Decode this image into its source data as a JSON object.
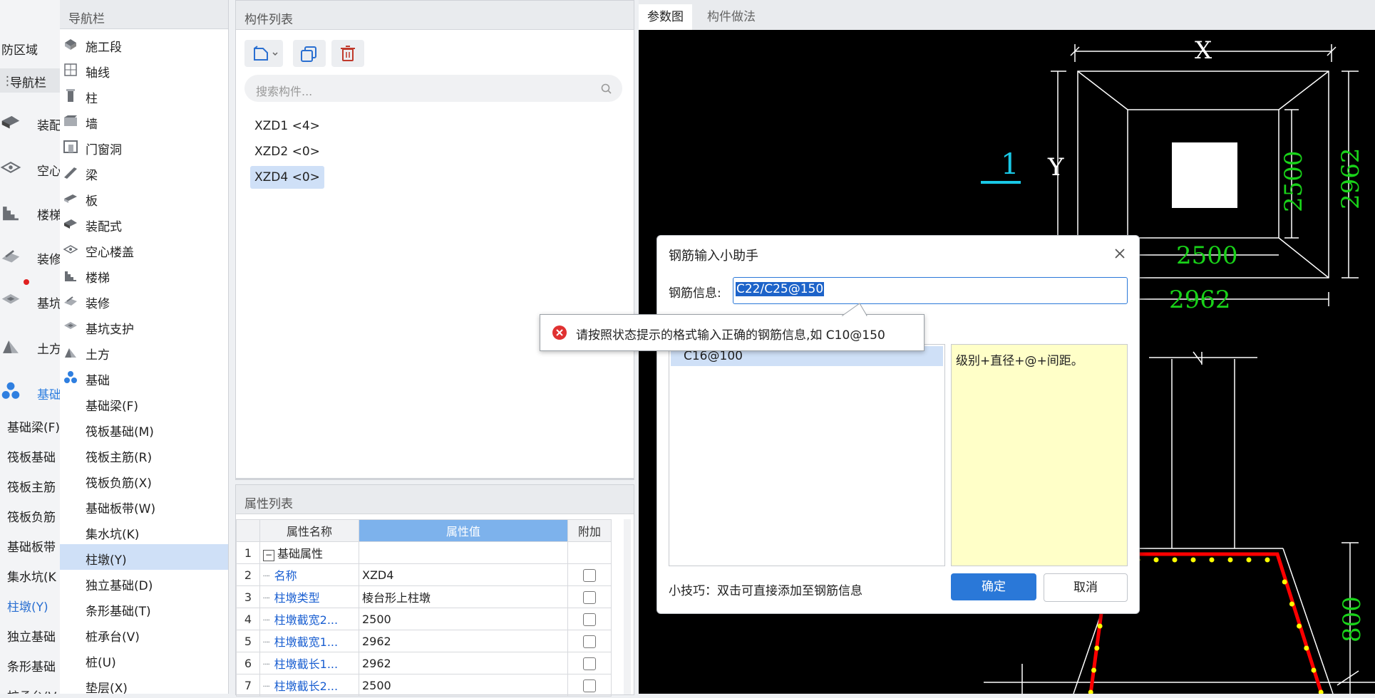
{
  "left_strip": {
    "top_label": "防区域",
    "nav_label": "导航栏",
    "items": [
      {
        "label": "装配",
        "icon": "prefab-icon"
      },
      {
        "label": "空心",
        "icon": "hollow-slab-icon"
      },
      {
        "label": "楼梯",
        "icon": "stairs-icon"
      },
      {
        "label": "装修",
        "icon": "decoration-icon"
      },
      {
        "label": "基坑",
        "icon": "pit-support-icon"
      },
      {
        "label": "土方",
        "icon": "earthwork-icon"
      },
      {
        "label": "基础",
        "icon": "foundation-icon"
      }
    ],
    "sub_items": [
      "基础梁(F)",
      "筏板基础",
      "筏板主筋",
      "筏板负筋",
      "基础板带",
      "集水坑(K",
      "柱墩(Y)",
      "独立基础",
      "条形基础",
      "桩承台(V"
    ]
  },
  "nav_panel": {
    "title": "导航栏",
    "items": [
      {
        "label": "施工段",
        "icon": "construction-segment-icon"
      },
      {
        "label": "轴线",
        "icon": "axis-grid-icon"
      },
      {
        "label": "柱",
        "icon": "column-icon"
      },
      {
        "label": "墙",
        "icon": "wall-icon"
      },
      {
        "label": "门窗洞",
        "icon": "door-window-icon"
      },
      {
        "label": "梁",
        "icon": "beam-icon"
      },
      {
        "label": "板",
        "icon": "slab-icon"
      },
      {
        "label": "装配式",
        "icon": "prefab-icon"
      },
      {
        "label": "空心楼盖",
        "icon": "hollow-slab-icon"
      },
      {
        "label": "楼梯",
        "icon": "stairs-icon"
      },
      {
        "label": "装修",
        "icon": "decoration-icon"
      },
      {
        "label": "基坑支护",
        "icon": "pit-support-icon"
      },
      {
        "label": "土方",
        "icon": "earthwork-icon"
      },
      {
        "label": "基础",
        "icon": "foundation-icon"
      }
    ],
    "sub_items": [
      "基础梁(F)",
      "筏板基础(M)",
      "筏板主筋(R)",
      "筏板负筋(X)",
      "基础板带(W)",
      "集水坑(K)",
      "柱墩(Y)",
      "独立基础(D)",
      "条形基础(T)",
      "桩承台(V)",
      "桩(U)",
      "垫层(X)"
    ],
    "selected_sub": "柱墩(Y)"
  },
  "component_list": {
    "title": "构件列表",
    "search_placeholder": "搜索构件...",
    "items": [
      "XZD1 <4>",
      "XZD2 <0>",
      "XZD4 <0>"
    ],
    "selected": "XZD4 <0>"
  },
  "property_list": {
    "title": "属性列表",
    "headers": [
      "属性名称",
      "属性值",
      "附加"
    ],
    "rows": [
      {
        "num": "1",
        "name": "基础属性",
        "value": "",
        "group": true
      },
      {
        "num": "2",
        "name": "名称",
        "value": "XZD4"
      },
      {
        "num": "3",
        "name": "柱墩类型",
        "value": "棱台形上柱墩"
      },
      {
        "num": "4",
        "name": "柱墩截宽2...",
        "value": "2500"
      },
      {
        "num": "5",
        "name": "柱墩截宽1...",
        "value": "2962"
      },
      {
        "num": "6",
        "name": "柱墩截长1...",
        "value": "2962"
      },
      {
        "num": "7",
        "name": "柱墩截长2...",
        "value": "2500"
      }
    ]
  },
  "drawing": {
    "tabs": [
      "参数图",
      "构件做法"
    ],
    "active_tab": "参数图",
    "labels": {
      "x": "X",
      "y": "Y",
      "section": "1",
      "dim_right_inner": "2500",
      "dim_right_outer": "2962",
      "dim_bottom_inner": "2500",
      "dim_bottom_outer": "2962",
      "dim_height": "800"
    },
    "colors": {
      "background": "#000000",
      "dimension": "#19d219",
      "line": "#ffffff",
      "section_mark": "#19c8e6",
      "rebar": "#ff0000",
      "rebar_dot": "#ffff00"
    }
  },
  "dialog": {
    "title": "钢筋输入小助手",
    "field_label": "钢筋信息:",
    "field_value": "C22/C25@150",
    "list_items": [
      "C16@100"
    ],
    "hint_text": "级别+直径+@+间距。",
    "tip": "小技巧：双击可直接添加至钢筋信息",
    "ok_label": "确定",
    "cancel_label": "取消",
    "error_message": "请按照状态提示的格式输入正确的钢筋信息,如 C10@150",
    "accent": "#2a78d8"
  }
}
